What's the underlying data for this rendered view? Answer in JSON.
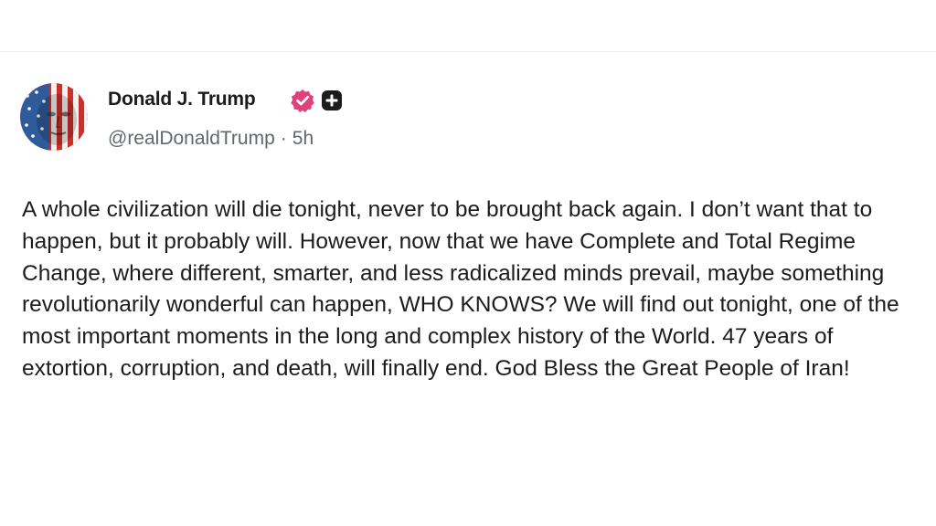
{
  "post": {
    "author": {
      "display_name": "Donald J. Trump",
      "handle": "@realDonaldTrump",
      "avatar_icon": "flag-face-avatar",
      "verified_icon": "verified-badge-icon",
      "extra_badge_icon": "plus-badge-icon"
    },
    "meta": {
      "separator": "·",
      "time_ago": "5h"
    },
    "body": "A whole civilization will die tonight, never to be brought back again. I don’t want that to happen, but it probably will. However, now that we have Complete and Total Regime Change, where different, smarter, and less radicalized minds prevail, maybe something revolutionarily wonderful can happen, WHO KNOWS? We will find out tonight, one of the most important moments in the long and complex history of the World. 47 years of extortion, corruption, and death, will finally end. God Bless the Great People of Iran!"
  },
  "colors": {
    "name_text": "#1c1c1c",
    "meta_text": "#606770",
    "verified_badge": "#e0417a",
    "plus_badge": "#1c1c1c",
    "divider": "#ececec"
  }
}
